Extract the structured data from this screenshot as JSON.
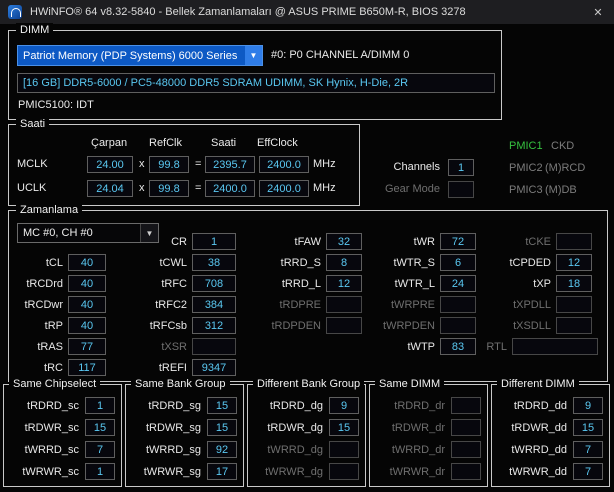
{
  "window": {
    "title": "HWiNFO® 64 v8.32-5840 - Bellek Zamanlamaları @ ASUS PRIME B650M-R, BIOS 3278",
    "close_glyph": "✕"
  },
  "glyphs": {
    "dropdown_arrow": "▼"
  },
  "colors": {
    "value_text": "#5ac8f2",
    "pmic_ok": "#35c13f",
    "dim_text": "#6f6f6f",
    "selection_blue": "#0d59c4"
  },
  "dimm": {
    "group_label": "DIMM",
    "selector_value": "Patriot Memory (PDP Systems) 6000 Series",
    "slot_label": "#0: P0 CHANNEL A/DIMM 0",
    "module_description": "[16 GB] DDR5-6000 / PC5-48000 DDR5 SDRAM UDIMM, SK Hynix, H-Die, 2R",
    "pmic_label": "PMIC5100: IDT"
  },
  "clock": {
    "group_label": "Saati",
    "headers": {
      "multiplier": "Çarpan",
      "refclk": "RefClk",
      "clock": "Saati",
      "effclock": "EffClock"
    },
    "mclk": {
      "name": "MCLK",
      "multiplier": "24.00",
      "times": "x",
      "refclk": "99.8",
      "equals": "=",
      "clock": "2395.7",
      "effclock": "2400.0",
      "unit": "MHz"
    },
    "uclk": {
      "name": "UCLK",
      "multiplier": "24.04",
      "times": "x",
      "refclk": "99.8",
      "equals": "=",
      "clock": "2400.0",
      "effclock": "2400.0",
      "unit": "MHz"
    }
  },
  "status": {
    "channels_label": "Channels",
    "channels_value": "1",
    "gear_mode_label": "Gear Mode",
    "gear_mode_value": "",
    "pmic1_label": "PMIC1",
    "pmic1_value": "CKD",
    "pmic2_label": "PMIC2",
    "pmic2_value": "(M)RCD",
    "pmic3_label": "PMIC3",
    "pmic3_value": "(M)DB"
  },
  "timings": {
    "group_label": "Zamanlama",
    "selector_value": "MC #0, CH #0",
    "col1": [
      {
        "label": "tCL",
        "value": "40"
      },
      {
        "label": "tRCDrd",
        "value": "40"
      },
      {
        "label": "tRCDwr",
        "value": "40"
      },
      {
        "label": "tRP",
        "value": "40"
      },
      {
        "label": "tRAS",
        "value": "77"
      },
      {
        "label": "tRC",
        "value": "117"
      }
    ],
    "col2": [
      {
        "label": "CR",
        "value": "1"
      },
      {
        "label": "tCWL",
        "value": "38"
      },
      {
        "label": "tRFC",
        "value": "708"
      },
      {
        "label": "tRFC2",
        "value": "384"
      },
      {
        "label": "tRFCsb",
        "value": "312"
      },
      {
        "label": "tXSR",
        "value": ""
      },
      {
        "label": "tREFI",
        "value": "9347"
      }
    ],
    "col3": [
      {
        "label": "tFAW",
        "value": "32"
      },
      {
        "label": "tRRD_S",
        "value": "8"
      },
      {
        "label": "tRRD_L",
        "value": "12"
      },
      {
        "label": "tRDPRE",
        "value": ""
      },
      {
        "label": "tRDPDEN",
        "value": ""
      }
    ],
    "col4": [
      {
        "label": "tWR",
        "value": "72"
      },
      {
        "label": "tWTR_S",
        "value": "6"
      },
      {
        "label": "tWTR_L",
        "value": "24"
      },
      {
        "label": "tWRPRE",
        "value": ""
      },
      {
        "label": "tWRPDEN",
        "value": ""
      },
      {
        "label": "tWTP",
        "value": "83"
      }
    ],
    "col5": [
      {
        "label": "tCKE",
        "value": ""
      },
      {
        "label": "tCPDED",
        "value": "12"
      },
      {
        "label": "tXP",
        "value": "18"
      },
      {
        "label": "tXPDLL",
        "value": ""
      },
      {
        "label": "tXSDLL",
        "value": ""
      }
    ],
    "rtl": {
      "label": "RTL",
      "value": ""
    }
  },
  "turnarounds": {
    "groups": [
      {
        "title": "Same Chipselect",
        "rows": [
          {
            "label": "tRDRD_sc",
            "value": "1"
          },
          {
            "label": "tRDWR_sc",
            "value": "15"
          },
          {
            "label": "tWRRD_sc",
            "value": "7"
          },
          {
            "label": "tWRWR_sc",
            "value": "1"
          }
        ]
      },
      {
        "title": "Same Bank Group",
        "rows": [
          {
            "label": "tRDRD_sg",
            "value": "15"
          },
          {
            "label": "tRDWR_sg",
            "value": "15"
          },
          {
            "label": "tWRRD_sg",
            "value": "92"
          },
          {
            "label": "tWRWR_sg",
            "value": "17"
          }
        ]
      },
      {
        "title": "Different Bank Group",
        "rows": [
          {
            "label": "tRDRD_dg",
            "value": "9"
          },
          {
            "label": "tRDWR_dg",
            "value": "15"
          },
          {
            "label": "tWRRD_dg",
            "value": ""
          },
          {
            "label": "tWRWR_dg",
            "value": ""
          }
        ]
      },
      {
        "title": "Same DIMM",
        "rows": [
          {
            "label": "tRDRD_dr",
            "value": ""
          },
          {
            "label": "tRDWR_dr",
            "value": ""
          },
          {
            "label": "tWRRD_dr",
            "value": ""
          },
          {
            "label": "tWRWR_dr",
            "value": ""
          }
        ]
      },
      {
        "title": "Different DIMM",
        "rows": [
          {
            "label": "tRDRD_dd",
            "value": "9"
          },
          {
            "label": "tRDWR_dd",
            "value": "15"
          },
          {
            "label": "tWRRD_dd",
            "value": "7"
          },
          {
            "label": "tWRWR_dd",
            "value": "7"
          }
        ]
      }
    ]
  }
}
